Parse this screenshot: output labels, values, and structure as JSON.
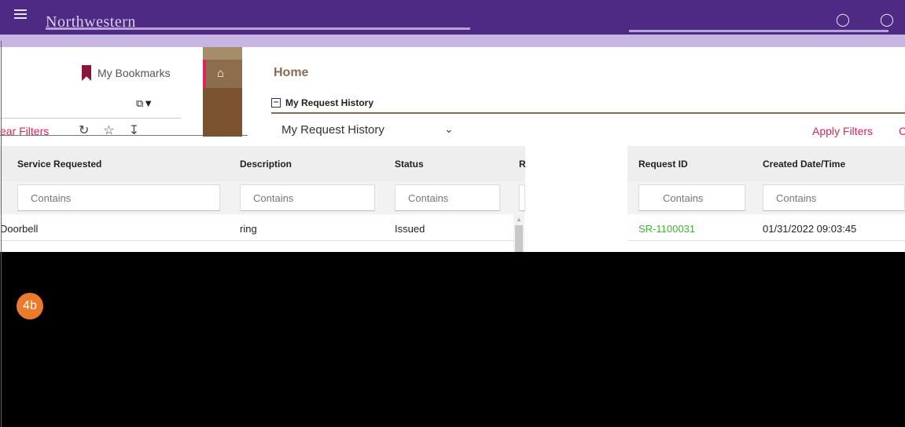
{
  "header": {
    "title": "Northwestern",
    "icons": [
      "menu-icon",
      "help-icon",
      "user-icon"
    ],
    "color": "#4e2a84"
  },
  "sidebar": {
    "bookmarks_label": "My Bookmarks",
    "clear_filters_label": "ear Filters"
  },
  "nav": {
    "home_icon": "home-icon"
  },
  "main": {
    "page_title": "Home",
    "section_title": "My Request History",
    "request_view": "My Request History",
    "apply_filters_label": "Apply Filters",
    "apply_filters_label2": "C"
  },
  "grid_left": {
    "columns": [
      "Service Requested",
      "Description",
      "Status",
      "R"
    ],
    "filter_placeholder": "Contains",
    "rows": [
      {
        "service": "Doorbell",
        "description": "ring",
        "status": "Issued"
      }
    ]
  },
  "grid_right": {
    "columns": [
      "Request ID",
      "Created Date/Time"
    ],
    "filter_placeholder": "Contains",
    "rows": [
      {
        "request_id": "SR-1100031",
        "created": "01/31/2022 09:03:45"
      }
    ]
  },
  "callout": {
    "step": "4b",
    "color": "#ea7a2c"
  }
}
